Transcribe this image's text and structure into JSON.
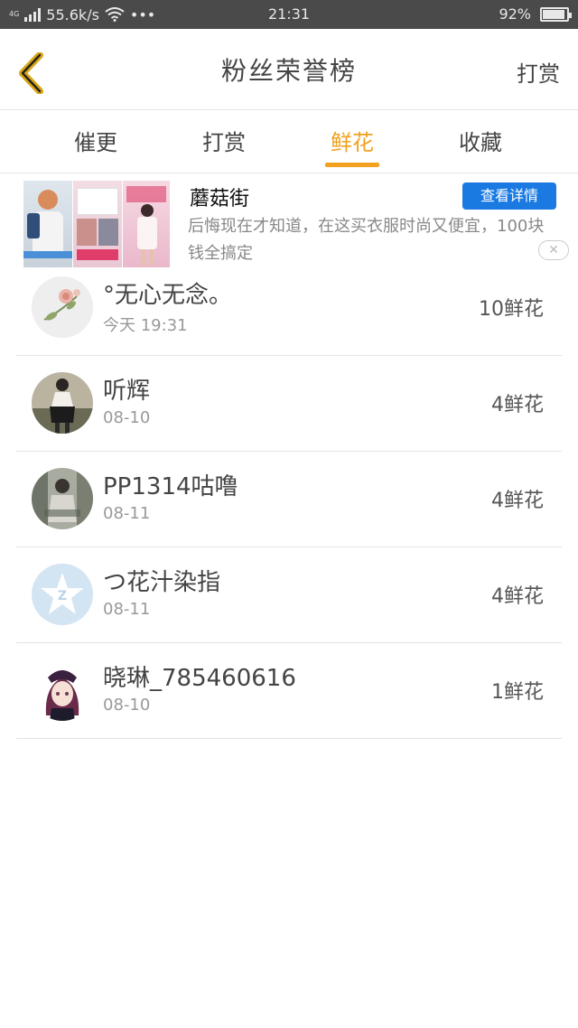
{
  "status_bar": {
    "network_type": "4G",
    "speed": "55.6k/s",
    "dots": "•••",
    "time": "21:31",
    "battery_text": "92%",
    "battery_level": 0.92
  },
  "header": {
    "title": "粉丝荣誉榜",
    "action_label": "打赏"
  },
  "tabs": [
    {
      "label": "催更",
      "active": false
    },
    {
      "label": "打赏",
      "active": false
    },
    {
      "label": "鲜花",
      "active": true
    },
    {
      "label": "收藏",
      "active": false
    }
  ],
  "ad": {
    "title": "蘑菇街",
    "button_label": "查看详情",
    "description": "后悔现在才知道，在这买衣服时尚又便宜，100块钱全搞定",
    "close_symbol": "✕"
  },
  "fans": [
    {
      "name": "°无心无念。",
      "date": "今天 19:31",
      "amount": "10鲜花",
      "avatar": "flower-painting-avatar"
    },
    {
      "name": "听辉",
      "date": "08-10",
      "amount": "4鲜花",
      "avatar": "girl-photo-avatar"
    },
    {
      "name": "PP1314咕噜",
      "date": "08-11",
      "amount": "4鲜花",
      "avatar": "street-photo-avatar"
    },
    {
      "name": "つ花汁染指",
      "date": "08-11",
      "amount": "4鲜花",
      "avatar": "qzone-default-avatar"
    },
    {
      "name": "晓琳_785460616",
      "date": "08-10",
      "amount": "1鲜花",
      "avatar": "anime-girl-avatar"
    }
  ],
  "colors": {
    "accent": "#f2a11f",
    "ad_button": "#1a7ae2",
    "status_bar": "#4a4a4a"
  }
}
